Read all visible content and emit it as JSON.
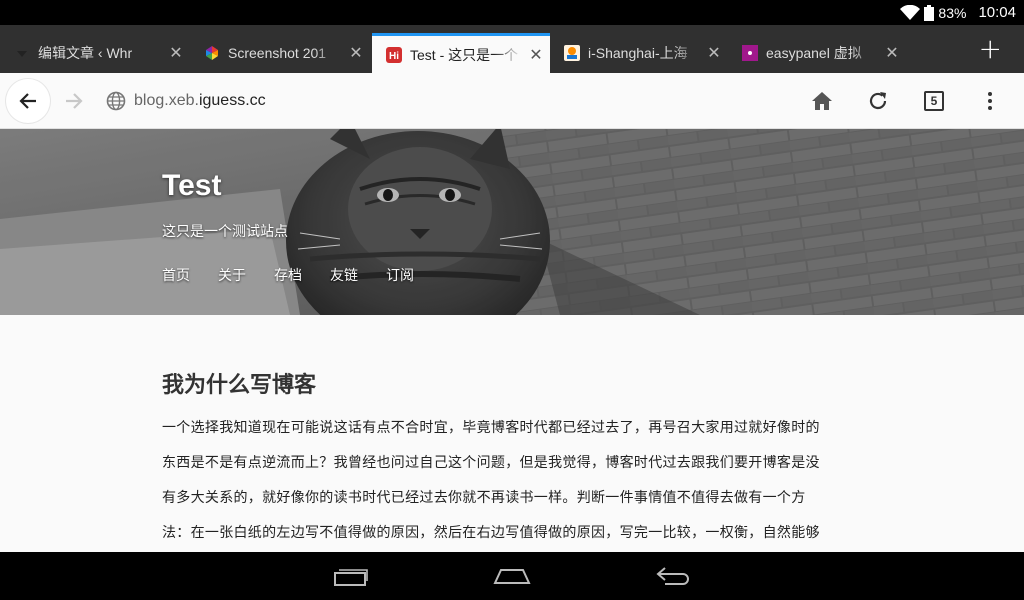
{
  "status": {
    "battery": "83%",
    "time": "10:04"
  },
  "tabs": [
    {
      "title": "编辑文章 ‹ Whr",
      "icon": "wordpress-icon",
      "active": false
    },
    {
      "title": "Screenshot 201",
      "icon": "screenshot-favicon-icon",
      "active": false
    },
    {
      "title": "Test - 这只是一个",
      "icon": "hi-favicon-icon",
      "active": true,
      "favicon_text": "Hi"
    },
    {
      "title": "i-Shanghai-上海",
      "icon": "ishanghai-favicon-icon",
      "active": false
    },
    {
      "title": "easypanel 虚拟",
      "icon": "easypanel-favicon-icon",
      "active": false
    }
  ],
  "tab_close_glyph": "✕",
  "new_tab_glyph": "+",
  "toolbar": {
    "url_host": "blog.xeb.",
    "url_domain": "iguess.cc",
    "tab_count": "5"
  },
  "site": {
    "title": "Test",
    "description": "这只是一个测试站点",
    "nav": [
      "首页",
      "关于",
      "存档",
      "友链",
      "订阅"
    ]
  },
  "article": {
    "heading": "我为什么写博客",
    "lines": [
      "一个选择我知道现在可能说这话有点不合时宜，毕竟博客时代都已经过去了，再号召大家用过就好像时的",
      "东西是不是有点逆流而上？我曾经也问过自己这个问题，但是我觉得，博客时代过去跟我们要开博客是没",
      "有多大关系的，就好像你的读书时代已经过去你就不再读书一样。判断一件事情值不值得去做有一个方",
      "法：在一张白纸的左边写不值得做的原因，然后在右边写值得做的原因，写完一比较，一权衡，自然能够"
    ]
  },
  "colors": {
    "active_tab_accent": "#2196f3",
    "tabstrip_bg": "#303030"
  }
}
